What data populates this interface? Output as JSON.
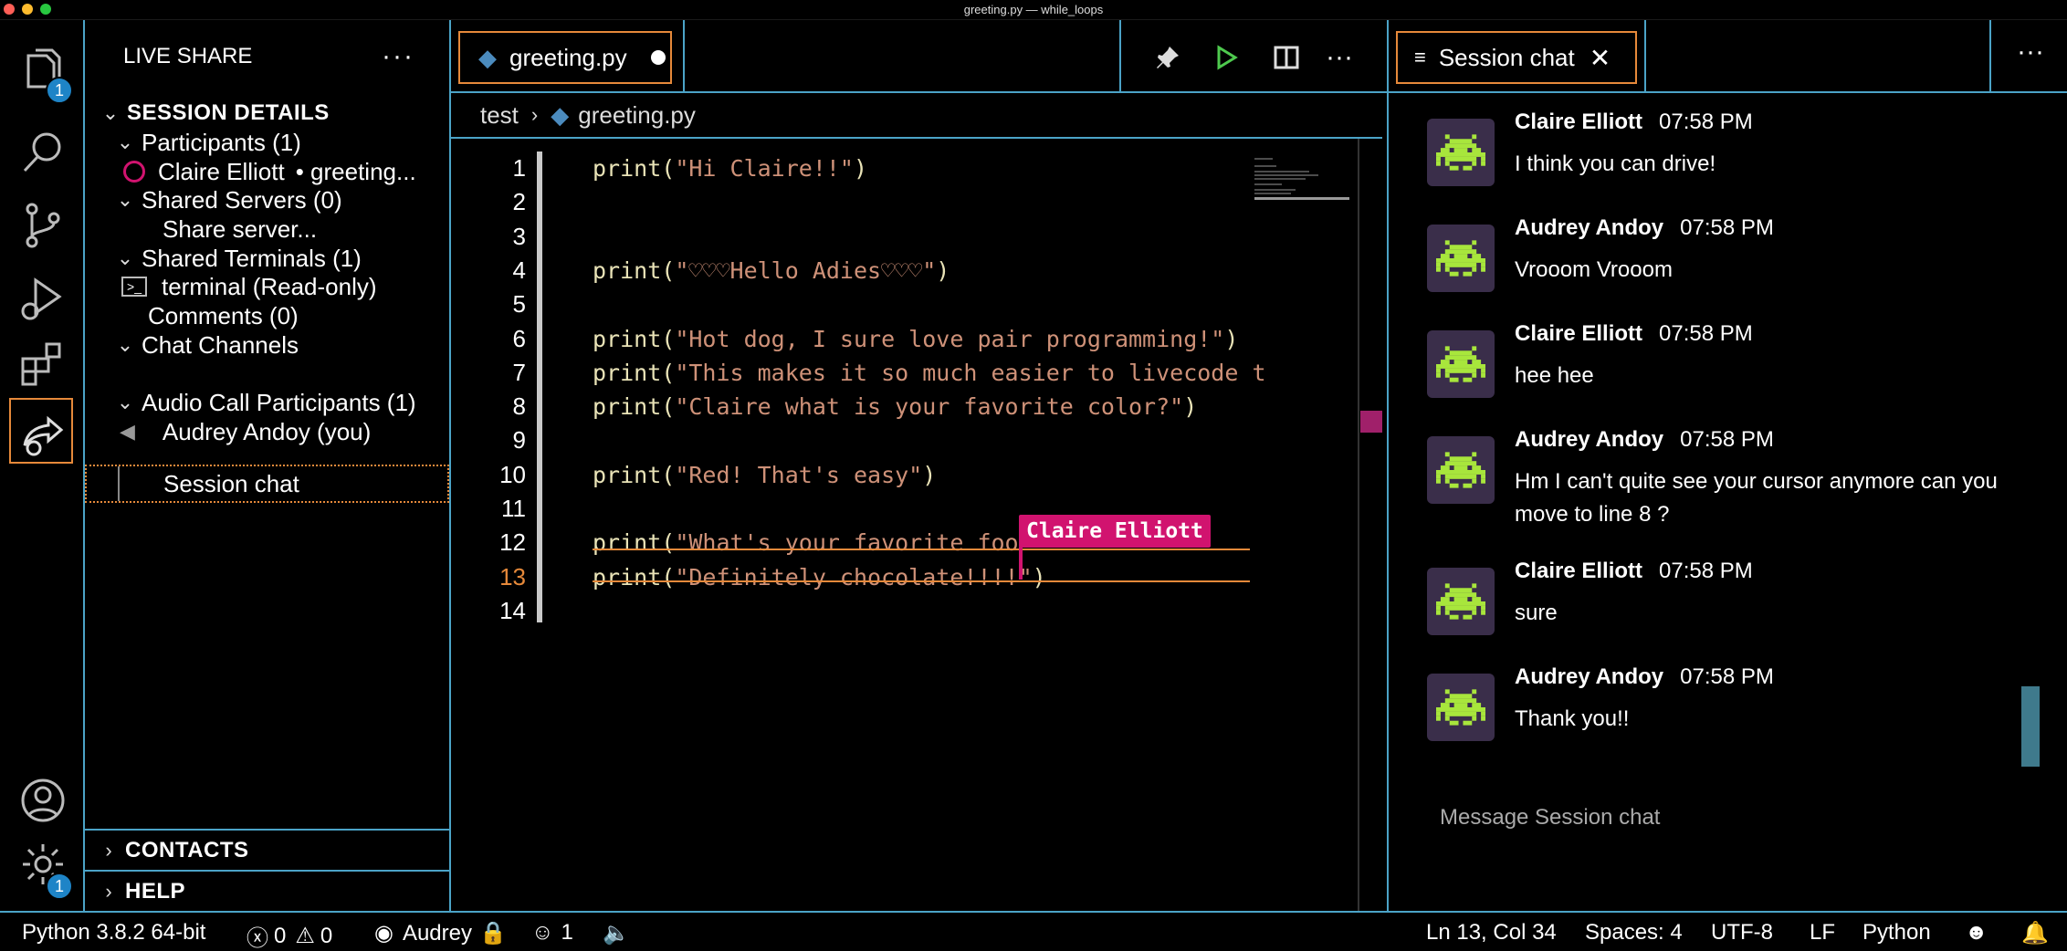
{
  "window": {
    "title": "greeting.py — while_loops"
  },
  "activity_bar": {
    "explorer_badge": "1",
    "settings_badge": "1"
  },
  "sidebar": {
    "title": "LIVE SHARE",
    "session_details": "SESSION DETAILS",
    "participants": "Participants (1)",
    "participant_name": "Claire Elliott",
    "participant_file": "• greeting...",
    "shared_servers": "Shared Servers (0)",
    "share_server": "Share server...",
    "shared_terminals": "Shared Terminals (1)",
    "terminal": "terminal (Read-only)",
    "comments": "Comments (0)",
    "chat_channels": "Chat Channels",
    "session_chat": "Session chat",
    "audio_participants": "Audio Call Participants (1)",
    "audio_user": "Audrey Andoy  (you)",
    "contacts": "CONTACTS",
    "help": "HELP"
  },
  "editor": {
    "tab_label": "greeting.py",
    "breadcrumb": {
      "folder": "test",
      "file": "greeting.py"
    },
    "lines": [
      {
        "n": "1",
        "fn": "print(",
        "str": "\"Hi Claire!!\"",
        "end": ")"
      },
      {
        "n": "2",
        "fn": "",
        "str": "",
        "end": ""
      },
      {
        "n": "3",
        "fn": "",
        "str": "",
        "end": ""
      },
      {
        "n": "4",
        "fn": "print(",
        "str": "\"♡♡♡Hello Adies♡♡♡\"",
        "end": ")"
      },
      {
        "n": "5",
        "fn": "",
        "str": "",
        "end": ""
      },
      {
        "n": "6",
        "fn": "print(",
        "str": "\"Hot dog, I sure love pair programming!\"",
        "end": ")"
      },
      {
        "n": "7",
        "fn": "print(",
        "str": "\"This makes it so much easier to livecode t",
        "end": ""
      },
      {
        "n": "8",
        "fn": "print(",
        "str": "\"Claire what is your favorite color?\"",
        "end": ")"
      },
      {
        "n": "9",
        "fn": "",
        "str": "",
        "end": ""
      },
      {
        "n": "10",
        "fn": "print(",
        "str": "\"Red! That's easy\"",
        "end": ")"
      },
      {
        "n": "11",
        "fn": "",
        "str": "",
        "end": ""
      },
      {
        "n": "12",
        "fn": "print(",
        "str": "\"What's your favorite foo",
        "end": ""
      },
      {
        "n": "13",
        "fn": "print(",
        "str": "\"Definitely chocolate!!!!\"",
        "end": ")"
      },
      {
        "n": "14",
        "fn": "",
        "str": "",
        "end": ""
      }
    ],
    "collaborator": "Claire Elliott"
  },
  "chat": {
    "tab_label": "Session chat",
    "messages": [
      {
        "name": "Claire Elliott",
        "time": "07:58 PM",
        "text": "I think you can drive!"
      },
      {
        "name": "Audrey Andoy",
        "time": "07:58 PM",
        "text": "Vrooom Vrooom"
      },
      {
        "name": "Claire Elliott",
        "time": "07:58 PM",
        "text": "hee hee"
      },
      {
        "name": "Audrey Andoy",
        "time": "07:58 PM",
        "text": "Hm I can't quite see your cursor anymore can you move to line 8 ?"
      },
      {
        "name": "Claire Elliott",
        "time": "07:58 PM",
        "text": "sure"
      },
      {
        "name": "Audrey Andoy",
        "time": "07:58 PM",
        "text": "Thank you!!"
      }
    ],
    "input_placeholder": "Message Session chat"
  },
  "statusbar": {
    "python": "Python 3.8.2 64-bit",
    "errors": "0",
    "warnings": "0",
    "liveshare_user": "Audrey",
    "participants_count": "1",
    "position": "Ln 13, Col 34",
    "spaces": "Spaces: 4",
    "encoding": "UTF-8",
    "eol": "LF",
    "language": "Python"
  },
  "colors": {
    "accent_border": "#4ba3c7",
    "focus": "#e6893a",
    "collaborator": "#d1136f",
    "string": "#ce9178",
    "function": "#e9e3b7"
  }
}
